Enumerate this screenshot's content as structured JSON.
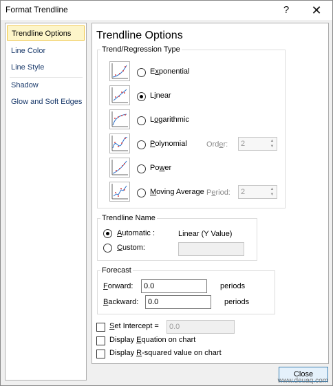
{
  "window": {
    "title": "Format Trendline",
    "help_label": "?",
    "close_x_label": "✕",
    "close_button_label": "Close",
    "watermark": "www.deuaq.com"
  },
  "nav": {
    "items": [
      {
        "label": "Trendline Options",
        "selected": true
      },
      {
        "label": "Line Color",
        "selected": false
      },
      {
        "label": "Line Style",
        "selected": false
      },
      {
        "label": "Shadow",
        "selected": false
      },
      {
        "label": "Glow and Soft Edges",
        "selected": false
      }
    ]
  },
  "panel": {
    "title": "Trendline Options",
    "regression": {
      "group_label": "Trend/Regression Type",
      "options": [
        {
          "key": "exponential",
          "pre": "E",
          "accel": "x",
          "post": "ponential",
          "selected": false
        },
        {
          "key": "linear",
          "pre": "L",
          "accel": "i",
          "post": "near",
          "selected": true
        },
        {
          "key": "logarithmic",
          "pre": "L",
          "accel": "o",
          "post": "garithmic",
          "selected": false
        },
        {
          "key": "polynomial",
          "pre": "",
          "accel": "P",
          "post": "olynomial",
          "selected": false
        },
        {
          "key": "power",
          "pre": "Po",
          "accel": "w",
          "post": "er",
          "selected": false
        },
        {
          "key": "moving_average",
          "pre": "",
          "accel": "M",
          "post": "oving Average",
          "selected": false
        }
      ],
      "order": {
        "pre": "Ord",
        "accel": "e",
        "post": "r:",
        "value": "2"
      },
      "period": {
        "pre": "P",
        "accel": "e",
        "post": "riod:",
        "value": "2"
      }
    },
    "trendline_name": {
      "group_label": "Trendline Name",
      "automatic": {
        "pre": "",
        "accel": "A",
        "post": "utomatic :",
        "selected": true,
        "value": "Linear (Y Value)"
      },
      "custom": {
        "pre": "",
        "accel": "C",
        "post": "ustom:",
        "selected": false,
        "value": ""
      }
    },
    "forecast": {
      "group_label": "Forecast",
      "forward": {
        "pre": "",
        "accel": "F",
        "post": "orward:",
        "value": "0.0",
        "unit": "periods"
      },
      "backward": {
        "pre": "",
        "accel": "B",
        "post": "ackward:",
        "value": "0.0",
        "unit": "periods"
      }
    },
    "checkboxes": {
      "set_intercept": {
        "pre": "",
        "accel": "S",
        "post": "et Intercept =",
        "value": "0.0",
        "checked": false
      },
      "display_equation": {
        "pre": "Display ",
        "accel": "E",
        "post": "quation on chart",
        "checked": false
      },
      "display_rsquared": {
        "pre": "Display ",
        "accel": "R",
        "post": "-squared value on chart",
        "checked": false
      }
    }
  }
}
